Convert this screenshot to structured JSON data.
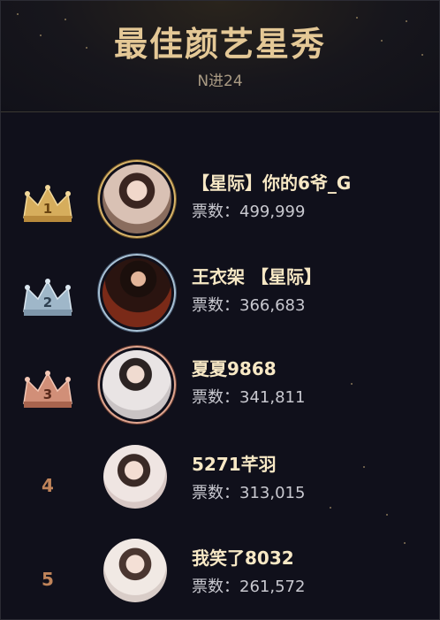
{
  "header": {
    "title": "最佳颜艺星秀",
    "subtitle": "N进24"
  },
  "votes_label": "票数：",
  "entries": [
    {
      "rank": "1",
      "name": "【星际】你的6爷_G",
      "votes": "499,999",
      "crown": "gold"
    },
    {
      "rank": "2",
      "name": "王衣架 【星际】",
      "votes": "366,683",
      "crown": "silver"
    },
    {
      "rank": "3",
      "name": "夏夏9868",
      "votes": "341,811",
      "crown": "bronze"
    },
    {
      "rank": "4",
      "name": "5271芊羽",
      "votes": "313,015",
      "crown": "none"
    },
    {
      "rank": "5",
      "name": "我笑了8032",
      "votes": "261,572",
      "crown": "none"
    }
  ],
  "colors": {
    "background": "#10101b",
    "title": "#e4c896",
    "name": "#f7e8c5",
    "gold": "#d9b56a",
    "silver": "#a9c2d6",
    "bronze": "#e0a690",
    "rank_number": "#c0845a"
  }
}
